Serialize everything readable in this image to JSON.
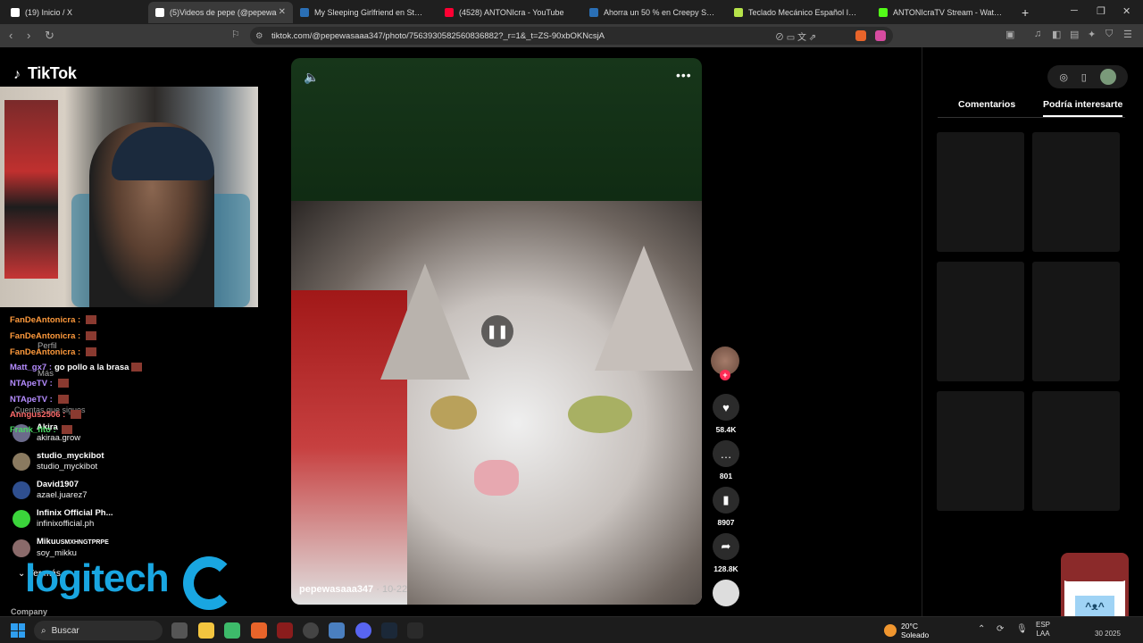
{
  "browser": {
    "tabs": [
      {
        "title": "(19) Inicio / X",
        "icon": "x-logo-icon",
        "icon_color": "#ffffff",
        "active": false
      },
      {
        "title": "(5)Videos de pepe (@pepewa",
        "icon": "tiktok-icon",
        "icon_color": "#ffffff",
        "active": true
      },
      {
        "title": "My Sleeping Girlfriend en Steam",
        "icon": "steam-icon",
        "icon_color": "#2a6fb5",
        "active": false
      },
      {
        "title": "(4528) ANTONIcra - YouTube",
        "icon": "youtube-icon",
        "icon_color": "#ff0033",
        "active": false
      },
      {
        "title": "Ahorra un 50 % en Creepy Shift: Roo",
        "icon": "steam-icon",
        "icon_color": "#2a6fb5",
        "active": false
      },
      {
        "title": "Teclado Mecánico Español Inalámbri",
        "icon": "store-icon",
        "icon_color": "#b6e34a",
        "active": false
      },
      {
        "title": "ANTONIcraTV Stream - Watch Live o",
        "icon": "kick-icon",
        "icon_color": "#53fc18",
        "active": false
      }
    ],
    "url": "tiktok.com/@pepewasaaa347/photo/7563930582560836882?_r=1&_t=ZS-90xbOKNcsjA"
  },
  "tiktok": {
    "logo": "TikTok",
    "sidebar": {
      "chat": [
        {
          "user": "FanDeAntonicra :",
          "msg": "",
          "color": "#ff9a3c"
        },
        {
          "user": "FanDeAntonicra :",
          "msg": "",
          "color": "#ff9a3c"
        },
        {
          "user": "FanDeAntonicra :",
          "msg": "",
          "color": "#ff9a3c"
        },
        {
          "user": "Matt_gx7 :",
          "msg": "go pollo a la brasa",
          "color": "#b58cff"
        },
        {
          "user": "NTApeTV :",
          "msg": "",
          "color": "#b58cff"
        },
        {
          "user": "NTApeTV :",
          "msg": "",
          "color": "#b58cff"
        },
        {
          "user": "Anngus2506 :",
          "msg": "",
          "color": "#ff6b6b"
        },
        {
          "user": "Frank_fito :",
          "msg": "",
          "color": "#4cd964"
        }
      ],
      "menu_profile": "Perfil",
      "menu_more": "Más",
      "following_header": "Cuentas que sigues",
      "following": [
        {
          "name": "Akira",
          "handle": "akiraa.grow",
          "color": "#6b6b8b"
        },
        {
          "name": "studio_myckibot",
          "handle": "studio_myckibot",
          "color": "#8a7a60"
        },
        {
          "name": "David1907",
          "handle": "azael.juarez7",
          "color": "#2f4f8f"
        },
        {
          "name": "Infinix Official Ph...",
          "handle": "infinixofficial.ph",
          "color": "#3bd43b"
        },
        {
          "name": "Miku",
          "handle": "soy_mikku",
          "color": "#8a6a6a",
          "suffix": "USMXHNGTPRPE"
        }
      ],
      "see_more": "Ver más",
      "company": "Company",
      "sponsor": "logitech"
    },
    "video": {
      "author": "pepewasaaa347",
      "date": " · 10-22",
      "likes": "58.4K",
      "comments": "801",
      "saves": "8907",
      "shares": "128.8K"
    },
    "right": {
      "tab_comments": "Comentarios",
      "tab_interest": "Podría interesarte"
    }
  },
  "taskbar": {
    "search": "Buscar",
    "weather_temp": "20°C",
    "weather_desc": "Soleado",
    "lang_top": "ESP",
    "lang_bottom": "LAA",
    "clock": "30",
    "year": "2025"
  }
}
